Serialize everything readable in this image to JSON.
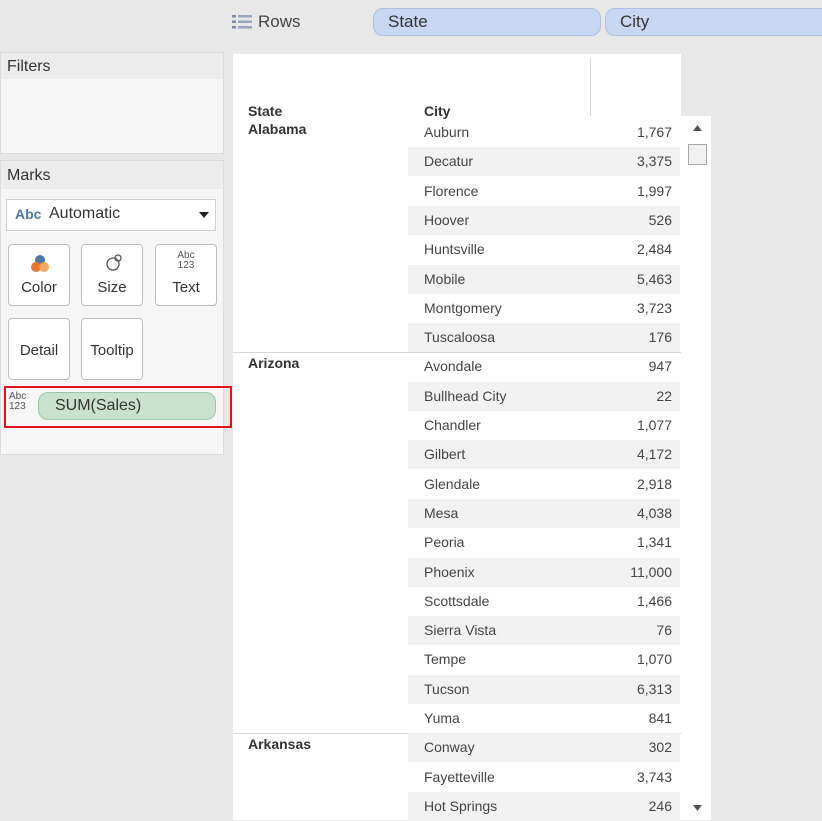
{
  "rows_shelf": {
    "label": "Rows",
    "pills": [
      "State",
      "City"
    ]
  },
  "filters": {
    "title": "Filters"
  },
  "marks": {
    "title": "Marks",
    "mark_type": "Automatic",
    "mark_type_prefix": "Abc",
    "buttons": {
      "color": "Color",
      "size": "Size",
      "text": "Text",
      "detail": "Detail",
      "tooltip": "Tooltip"
    },
    "text_icon_top": "Abc",
    "text_icon_bottom": "123",
    "field_pill": "SUM(Sales)",
    "highlight_color": "#e0141e"
  },
  "table": {
    "headers": {
      "state": "State",
      "city": "City"
    },
    "groups": [
      {
        "state": "Alabama",
        "rows": [
          {
            "city": "Auburn",
            "value": "1,767"
          },
          {
            "city": "Decatur",
            "value": "3,375"
          },
          {
            "city": "Florence",
            "value": "1,997"
          },
          {
            "city": "Hoover",
            "value": "526"
          },
          {
            "city": "Huntsville",
            "value": "2,484"
          },
          {
            "city": "Mobile",
            "value": "5,463"
          },
          {
            "city": "Montgomery",
            "value": "3,723"
          },
          {
            "city": "Tuscaloosa",
            "value": "176"
          }
        ]
      },
      {
        "state": "Arizona",
        "rows": [
          {
            "city": "Avondale",
            "value": "947"
          },
          {
            "city": "Bullhead City",
            "value": "22"
          },
          {
            "city": "Chandler",
            "value": "1,077"
          },
          {
            "city": "Gilbert",
            "value": "4,172"
          },
          {
            "city": "Glendale",
            "value": "2,918"
          },
          {
            "city": "Mesa",
            "value": "4,038"
          },
          {
            "city": "Peoria",
            "value": "1,341"
          },
          {
            "city": "Phoenix",
            "value": "11,000"
          },
          {
            "city": "Scottsdale",
            "value": "1,466"
          },
          {
            "city": "Sierra Vista",
            "value": "76"
          },
          {
            "city": "Tempe",
            "value": "1,070"
          },
          {
            "city": "Tucson",
            "value": "6,313"
          },
          {
            "city": "Yuma",
            "value": "841"
          }
        ]
      },
      {
        "state": "Arkansas",
        "rows": [
          {
            "city": "Conway",
            "value": "302"
          },
          {
            "city": "Fayetteville",
            "value": "3,743"
          },
          {
            "city": "Hot Springs",
            "value": "246"
          }
        ]
      }
    ]
  },
  "colors": {
    "pill_blue": "#c8d8f2",
    "pill_green": "#c9e2cf",
    "color_icon_orange": "#e8762c",
    "color_icon_blue": "#4e79a7"
  }
}
